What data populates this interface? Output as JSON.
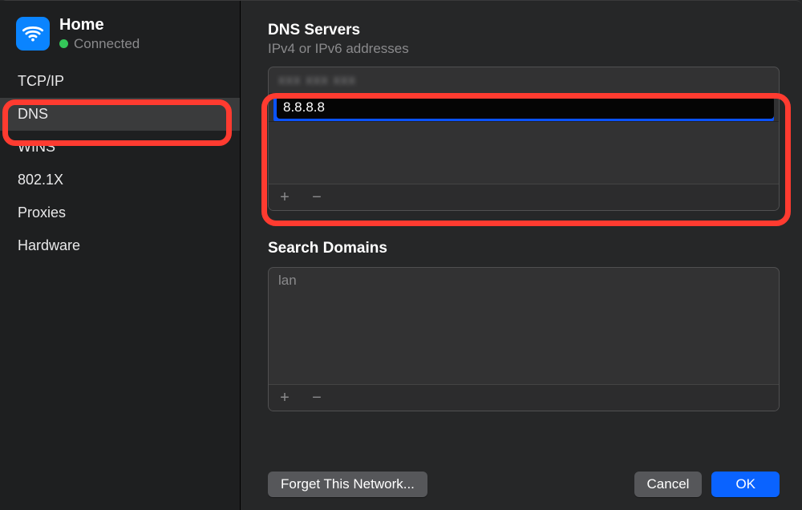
{
  "network": {
    "name": "Home",
    "status": "Connected",
    "status_color": "#34c759",
    "icon": "wifi-icon"
  },
  "tabs": [
    {
      "id": "tcpip",
      "label": "TCP/IP",
      "selected": false
    },
    {
      "id": "dns",
      "label": "DNS",
      "selected": true
    },
    {
      "id": "wins",
      "label": "WINS",
      "selected": false
    },
    {
      "id": "8021x",
      "label": "802.1X",
      "selected": false
    },
    {
      "id": "proxies",
      "label": "Proxies",
      "selected": false
    },
    {
      "id": "hardware",
      "label": "Hardware",
      "selected": false
    }
  ],
  "dns": {
    "section_title": "DNS Servers",
    "section_subtitle": "IPv4 or IPv6 addresses",
    "rows": [
      {
        "value": "xxx xxx xxx",
        "blurred": true,
        "editing": false
      },
      {
        "value": "8.8.8.8",
        "blurred": false,
        "editing": true
      }
    ],
    "add_label": "+",
    "remove_label": "−"
  },
  "search_domains": {
    "section_title": "Search Domains",
    "rows": [
      {
        "value": "lan"
      }
    ],
    "add_label": "+",
    "remove_label": "−"
  },
  "footer": {
    "forget_label": "Forget This Network...",
    "cancel_label": "Cancel",
    "ok_label": "OK"
  },
  "annotations": {
    "sidebar_highlight": true,
    "main_highlight": true,
    "highlight_color": "#ff3b30"
  }
}
